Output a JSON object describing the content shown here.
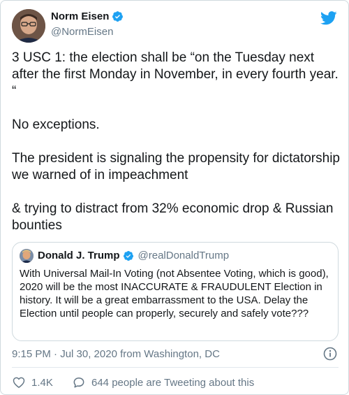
{
  "tweet": {
    "author": {
      "name": "Norm Eisen",
      "handle": "@NormEisen",
      "verified": true
    },
    "text": {
      "line1": "3 USC 1: the election shall be  “on the Tuesday next after the first Monday in November, in every fourth year. “",
      "line2": "No exceptions.",
      "line3": "The president is signaling the propensity for dictatorship we warned of in impeachment",
      "line4": "& trying to distract from 32% economic drop & Russian bounties"
    },
    "timestamp": "9:15 PM · Jul 30, 2020 from Washington, DC",
    "likes": "1.4K",
    "replies_text": "644 people are Tweeting about this"
  },
  "quoted_tweet": {
    "author": {
      "name": "Donald J. Trump",
      "handle": "@realDonaldTrump",
      "verified": true
    },
    "text": "With Universal Mail-In Voting (not Absentee Voting, which is good), 2020 will be the most INACCURATE & FRAUDULENT Election in history. It will be a great embarrassment to the USA. Delay the Election until people can properly, securely and safely vote???"
  },
  "icons": {
    "brand": "twitter-bird-icon",
    "verified": "verified-badge-icon",
    "info": "info-icon",
    "like": "heart-icon",
    "reply": "speech-bubble-icon"
  },
  "colors": {
    "brand": "#1da1f2",
    "verified": "#1da1f2",
    "secondary_text": "#657786"
  }
}
